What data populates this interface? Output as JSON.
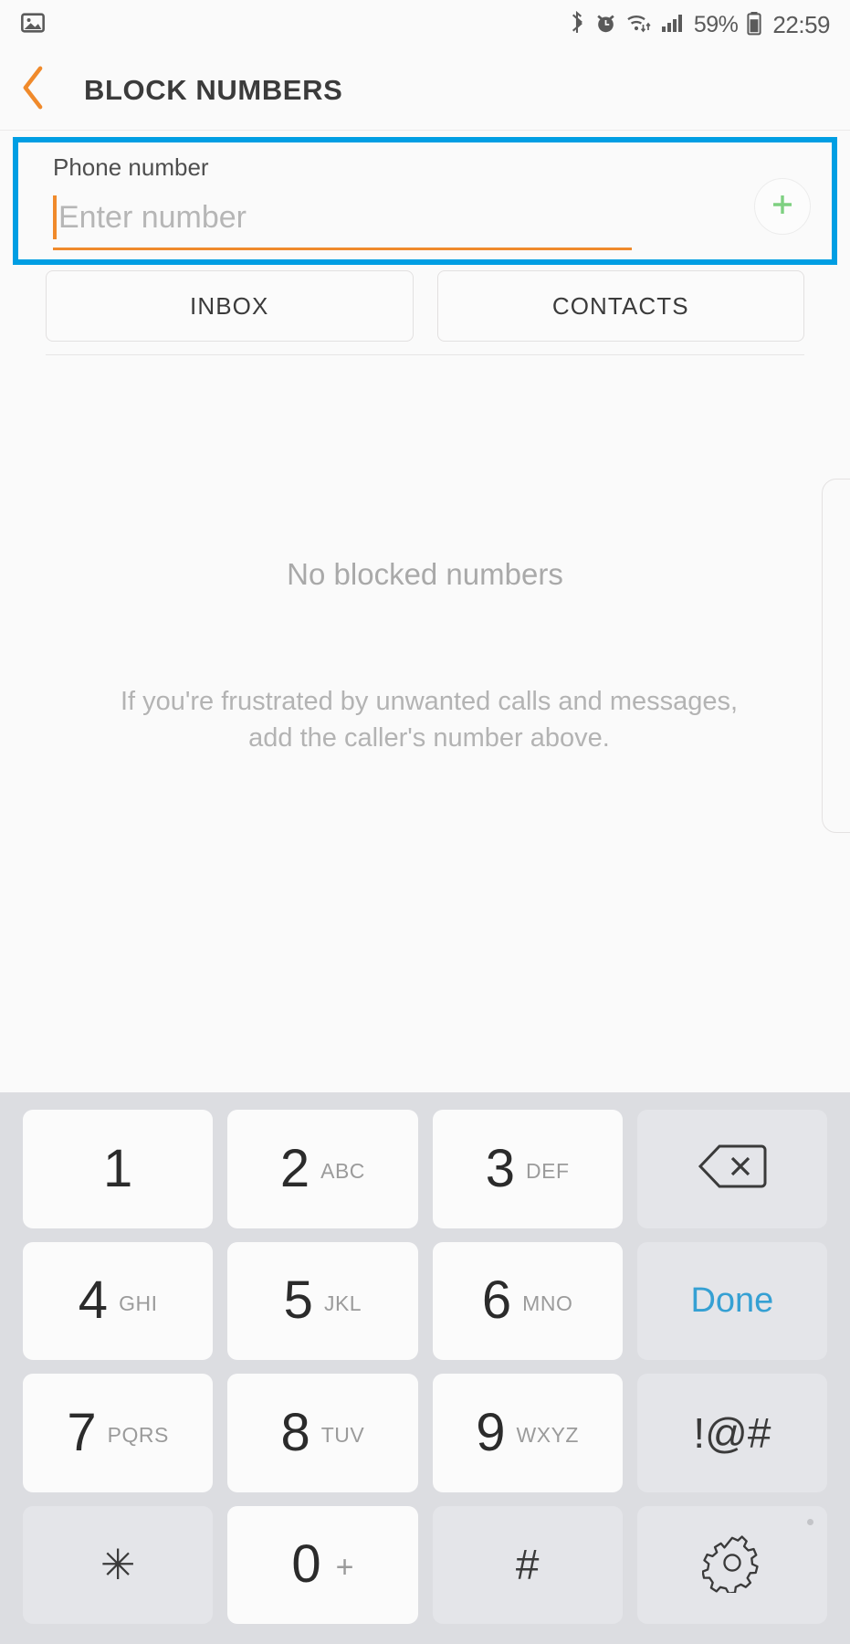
{
  "status_bar": {
    "left_icons": [
      "image-icon"
    ],
    "right_icons": [
      "bluetooth-icon",
      "alarm-icon",
      "wifi-icon",
      "signal-icon",
      "battery-icon"
    ],
    "battery_percent": "59%",
    "clock": "22:59"
  },
  "app_bar": {
    "back_icon": "chevron-left-icon",
    "title": "BLOCK NUMBERS",
    "accent_color": "#f08a2b"
  },
  "number_field": {
    "label": "Phone number",
    "value": "",
    "placeholder": "Enter number",
    "add_icon": "plus-icon",
    "add_icon_color": "#7ed081",
    "underline_color": "#f08a2b",
    "highlight_color": "#009ee3"
  },
  "source_buttons": [
    {
      "label": "INBOX",
      "name": "inbox-button"
    },
    {
      "label": "CONTACTS",
      "name": "contacts-button"
    }
  ],
  "empty_state": {
    "title": "No blocked numbers",
    "description": "If you're frustrated by unwanted calls and messages, add the caller's number above."
  },
  "keypad": {
    "background": "#dcdde1",
    "done_color": "#35a0d3",
    "keys": [
      {
        "name": "key-1",
        "digit": "1",
        "letters": "",
        "style": "white",
        "type": "digit"
      },
      {
        "name": "key-2",
        "digit": "2",
        "letters": "ABC",
        "style": "white",
        "type": "digit"
      },
      {
        "name": "key-3",
        "digit": "3",
        "letters": "DEF",
        "style": "white",
        "type": "digit"
      },
      {
        "name": "key-backspace",
        "digit": "",
        "letters": "",
        "style": "alt",
        "type": "backspace-icon"
      },
      {
        "name": "key-4",
        "digit": "4",
        "letters": "GHI",
        "style": "white",
        "type": "digit"
      },
      {
        "name": "key-5",
        "digit": "5",
        "letters": "JKL",
        "style": "white",
        "type": "digit"
      },
      {
        "name": "key-6",
        "digit": "6",
        "letters": "MNO",
        "style": "white",
        "type": "digit"
      },
      {
        "name": "key-done",
        "digit": "",
        "letters": "",
        "style": "alt",
        "type": "done",
        "label": "Done"
      },
      {
        "name": "key-7",
        "digit": "7",
        "letters": "PQRS",
        "style": "white",
        "type": "digit"
      },
      {
        "name": "key-8",
        "digit": "8",
        "letters": "TUV",
        "style": "white",
        "type": "digit"
      },
      {
        "name": "key-9",
        "digit": "9",
        "letters": "WXYZ",
        "style": "white",
        "type": "digit"
      },
      {
        "name": "key-symbols",
        "digit": "",
        "letters": "",
        "style": "alt",
        "type": "symbol",
        "label": "!@#"
      },
      {
        "name": "key-star",
        "digit": "",
        "letters": "",
        "style": "alt",
        "type": "symbol",
        "label": "✳"
      },
      {
        "name": "key-0",
        "digit": "0",
        "letters": "",
        "style": "white",
        "type": "zero",
        "plus": "+"
      },
      {
        "name": "key-hash",
        "digit": "",
        "letters": "",
        "style": "alt",
        "type": "symbol",
        "label": "#"
      },
      {
        "name": "key-settings",
        "digit": "",
        "letters": "",
        "style": "alt",
        "type": "settings-icon"
      }
    ]
  }
}
